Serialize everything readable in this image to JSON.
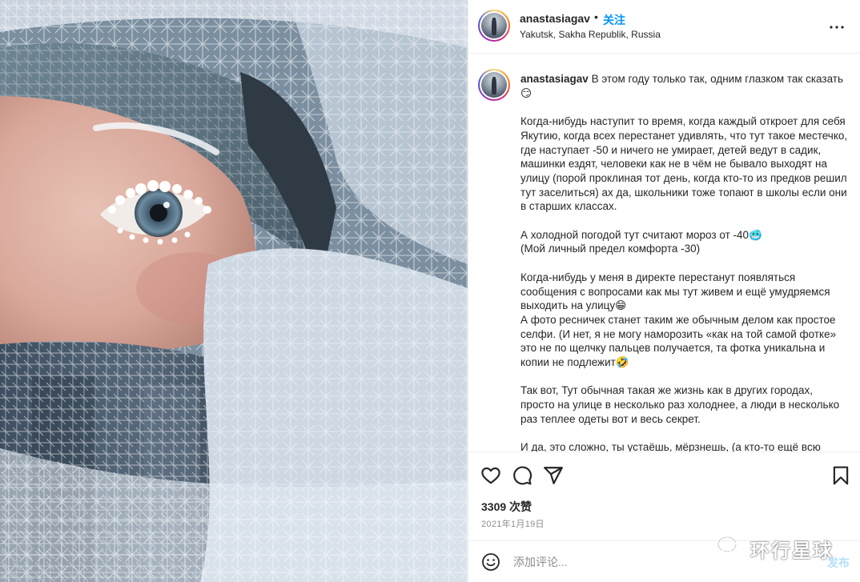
{
  "post": {
    "username": "anastasiagav",
    "separator": "•",
    "follow_label": "关注",
    "location": "Yakutsk, Sakha Republik, Russia",
    "more_icon": "more-horizontal-icon"
  },
  "caption": {
    "username": "anastasiagav",
    "text": " В этом году только так, одним глазком так сказать😏\n\nКогда-нибудь наступит то время, когда каждый откроет для себя Якутию, когда всех перестанет удивлять, что тут такое местечко, где наступает -50 и ничего не умирает, детей ведут в садик, машинки ездят, человеки как не в чём не бывало выходят на улицу (порой проклиная тот день, когда кто-то из предков решил тут заселиться) ах да, школьники тоже топают в школы если они в старших классах.\n\nА холодной погодой тут считают мороз от -40🥶\n(Мой личный предел комфорта -30)\n\nКогда-нибудь у меня в директе перестанут появляться сообщения с вопросами как мы тут живем и ещё умудряемся выходить на улицу😁\nА фото ресничек станет таким же обычным делом как простое селфи. (И нет, я не могу наморозить «как на той самой фотке» это не по щелчку пальцев получается, та фотка уникальна и копии не подлежит🤣\n\nТак вот, Тут обычная такая же жизнь как в других городах, просто на улице в несколько раз холоднее, а люди в несколько раз теплее одеты вот и весь секрет.\n\nИ да, это сложно, ты устаёшь, мёрзнешь, (а кто-то ещё всю"
  },
  "actions": {
    "like_icon": "heart-icon",
    "comment_icon": "comment-icon",
    "share_icon": "share-icon",
    "save_icon": "bookmark-icon",
    "likes": "3309 次赞",
    "date": "2021年1月19日"
  },
  "comment": {
    "emoji_icon": "smile-icon",
    "placeholder": "添加评论...",
    "post_label": "发布"
  },
  "watermark": {
    "text": "环行星球",
    "icon": "wechat-icon"
  },
  "colors": {
    "accent": "#0095f6",
    "post_disabled": "#b2dffc",
    "muted": "#8e8e8e",
    "border": "#efefef"
  }
}
